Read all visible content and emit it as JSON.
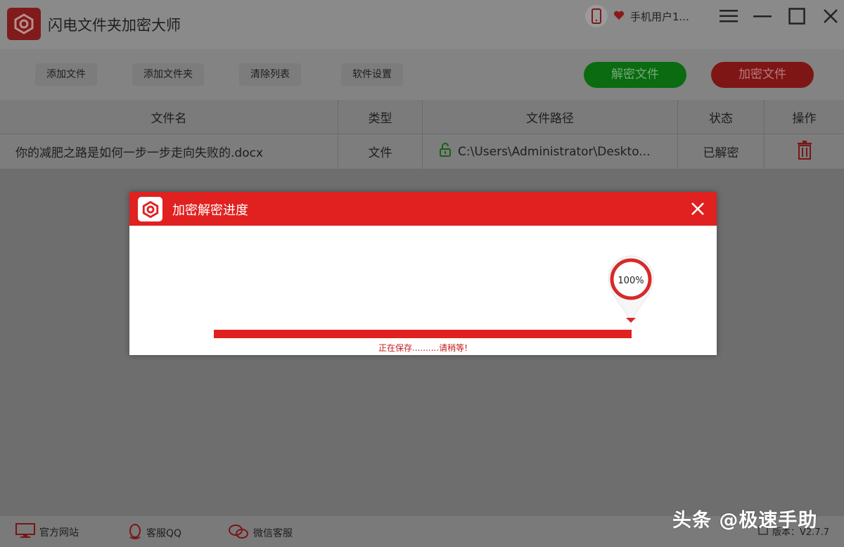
{
  "app": {
    "title": "闪电文件夹加密大师",
    "user_name": "手机用户1..."
  },
  "toolbar": {
    "add_file": "添加文件",
    "add_folder": "添加文件夹",
    "clear_list": "清除列表",
    "settings": "软件设置",
    "decrypt_button": "解密文件",
    "encrypt_button": "加密文件"
  },
  "table": {
    "headers": [
      "文件名",
      "类型",
      "文件路径",
      "状态",
      "操作"
    ],
    "rows": [
      {
        "name": "你的减肥之路是如何一步一步走向失败的.docx",
        "type": "文件",
        "path": "C:\\Users\\Administrator\\Deskto...",
        "status": "已解密"
      }
    ]
  },
  "dialog": {
    "title": "加密解密进度",
    "percent_label": "100%",
    "progress": 1.0,
    "status_text": "正在保存..........请稍等!"
  },
  "footer": {
    "website": "官方网站",
    "qq": "客服QQ",
    "wechat": "微信客服",
    "version": "版本：V2.7.7"
  },
  "watermark": "头条 @极速手助",
  "colors": {
    "accent_red": "#e0211f",
    "decrypt_green": "#0a6b10",
    "encrypt_red": "#7e1616"
  },
  "icons": {
    "app_logo": "app-logo-icon",
    "phone": "phone-icon",
    "vip": "vip-heart-icon",
    "menu": "hamburger-menu-icon",
    "minimize": "minimize-icon",
    "maximize": "maximize-icon",
    "close": "close-icon",
    "unlock": "unlock-icon",
    "delete": "trash-icon",
    "monitor": "monitor-icon",
    "qq": "qq-penguin-icon",
    "wechat": "wechat-icon"
  }
}
